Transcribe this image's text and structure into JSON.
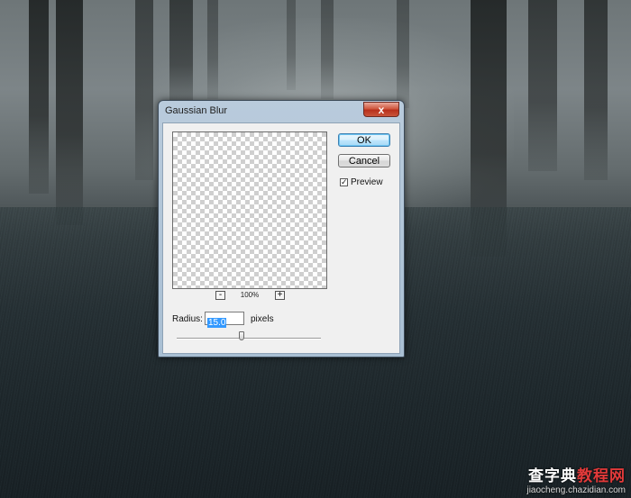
{
  "dialog": {
    "title": "Gaussian Blur",
    "close_glyph": "x",
    "preview_zoom": {
      "out_label": "-",
      "in_label": "+",
      "level": "100%"
    },
    "buttons": {
      "ok": "OK",
      "cancel": "Cancel"
    },
    "preview_checkbox": {
      "label": "Preview",
      "checked": true,
      "check_glyph": "✓"
    },
    "radius": {
      "label": "Radius:",
      "value": "15.0",
      "units": "pixels",
      "slider_position": 0.45
    }
  },
  "watermark": {
    "title_part1": "查字典",
    "title_part2": "教程网",
    "url": "jiaocheng.chazidian.com"
  },
  "colors": {
    "selection": "#3399ff",
    "ok_accent": "#3c7fb1",
    "close_button": "#c9543a"
  }
}
